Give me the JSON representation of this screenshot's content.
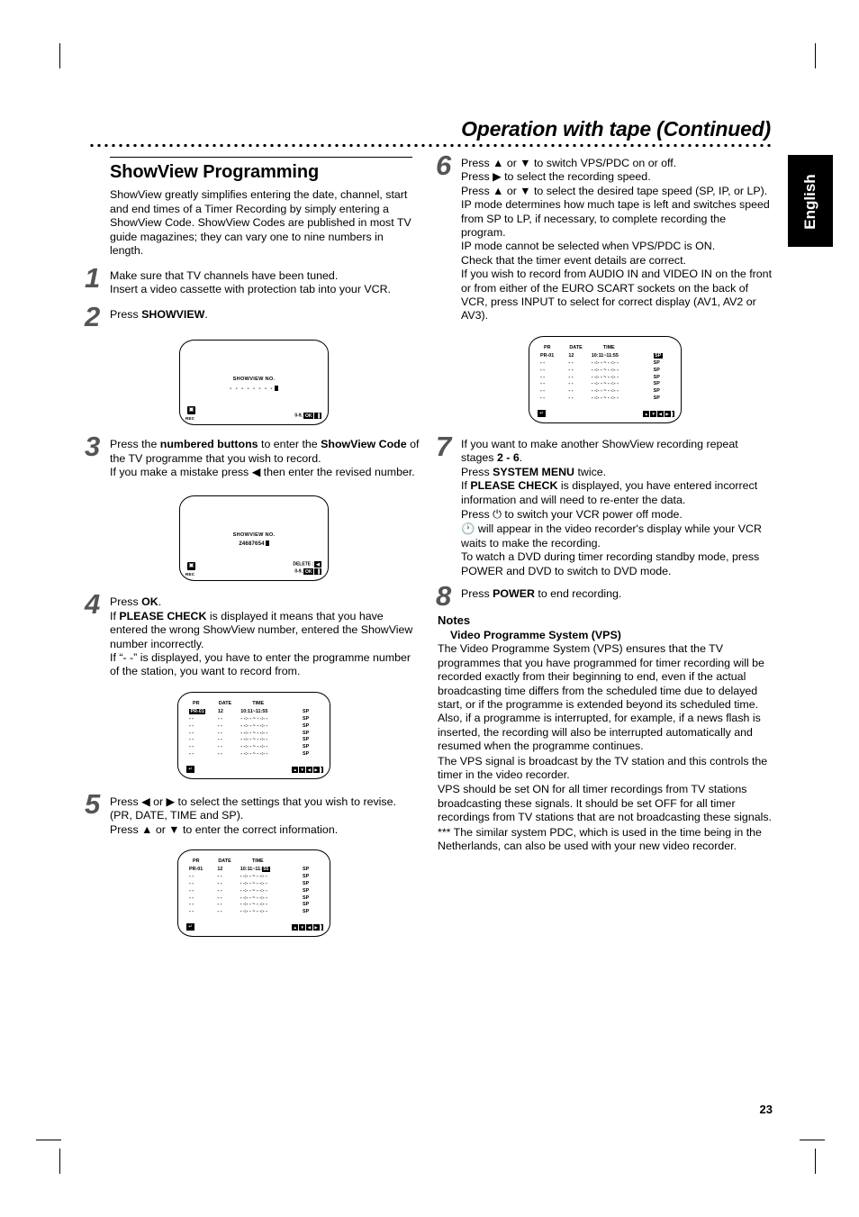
{
  "header": {
    "title": "Operation with tape (Continued)",
    "language_tab": "English",
    "page_number": "23"
  },
  "left_column": {
    "section_title": "ShowView Programming",
    "intro": "ShowView greatly simplifies entering the date, channel, start and end times of a Timer Recording by simply entering a ShowView Code. ShowView Codes are published in most TV guide magazines; they can vary one to nine numbers in length.",
    "steps": [
      {
        "number": "1",
        "lines": [
          "Make sure that TV channels have been tuned.",
          "Insert a video cassette with protection tab into your VCR."
        ]
      },
      {
        "number": "2",
        "lines": [
          "Press SHOWVIEW."
        ],
        "bold_terms": [
          "SHOWVIEW"
        ]
      },
      {
        "number": "3",
        "lines": [
          "Press the numbered buttons to enter the ShowView Code of the TV programme that you wish to record.",
          "If you make a mistake press ◀ then enter the revised number."
        ],
        "bold_terms": [
          "numbered buttons",
          "ShowView Code"
        ]
      },
      {
        "number": "4",
        "lines": [
          "Press OK.",
          "If PLEASE CHECK is displayed it means that you have entered the wrong ShowView number, entered the ShowView number incorrectly.",
          "If “- -” is displayed, you have to enter the programme number of the station, you want to record from."
        ],
        "bold_terms": [
          "OK",
          "PLEASE CHECK"
        ]
      },
      {
        "number": "5",
        "lines": [
          "Press ◀ or ▶ to select the settings that you wish to revise. (PR, DATE, TIME and SP).",
          "Press ▲ or ▼ to enter the correct information."
        ]
      }
    ]
  },
  "right_column": {
    "steps": [
      {
        "number": "6",
        "lines": [
          "Press ▲ or ▼ to switch VPS/PDC on or off.",
          "Press ▶ to select the recording speed.",
          "Press ▲ or ▼ to select the desired tape speed (SP, IP, or LP).",
          "IP mode determines how much tape is left and switches speed from SP to LP, if necessary, to  complete recording the program.",
          "IP mode cannot be selected when VPS/PDC is ON.",
          "Check that the timer event details are correct.",
          "If you wish to record from AUDIO IN and VIDEO IN on the front or from either of the EURO SCART sockets on the back of VCR, press INPUT to select for correct display (AV1, AV2 or AV3)."
        ]
      },
      {
        "number": "7",
        "lines": [
          "If you want to make another ShowView recording repeat stages 2 - 6.",
          "Press SYSTEM MENU twice.",
          "If PLEASE CHECK is displayed, you have entered incorrect information and will need to re-enter the data.",
          "Press ⏻ to switch your VCR power off mode.",
          "🕐 will appear in the video recorder's display while your VCR waits to make the recording.",
          "To watch a DVD during timer recording standby mode, press POWER and DVD to switch to DVD mode."
        ],
        "bold_terms": [
          "2 - 6",
          "SYSTEM MENU",
          "PLEASE CHECK"
        ]
      },
      {
        "number": "8",
        "lines": [
          "Press POWER to end recording."
        ],
        "bold_terms": [
          "POWER"
        ]
      }
    ],
    "notes": {
      "heading": "Notes",
      "subheading": "Video Programme System (VPS)",
      "paragraphs": [
        "The Video Programme System (VPS) ensures that the TV programmes that you have programmed for timer recording will be recorded exactly from their beginning to end, even if the actual broadcasting time differs from the scheduled time due to delayed start, or if the programme is extended beyond its scheduled time. Also, if a programme is interrupted, for example, if a news flash is inserted, the recording will also be interrupted automatically and resumed when the programme continues.",
        "The VPS signal is broadcast by the TV station and this controls the timer in the video recorder.",
        "VPS should be set ON for all timer recordings from TV stations broadcasting these signals. It should be set OFF for all timer recordings from TV stations that are not broadcasting these signals.",
        "*** The similar system PDC, which is used in the time being in the Netherlands, can also be used with your new video recorder."
      ]
    }
  },
  "screens": {
    "showview_empty": {
      "title": "SHOWVIEW NO.",
      "code": "- - - - - - - -",
      "rec_label": "REC",
      "hint": "0-9,",
      "ok_label": "OK"
    },
    "showview_filled": {
      "title": "SHOWVIEW NO.",
      "code": "24687654",
      "rec_label": "REC",
      "delete_label": "DELETE :",
      "delete_key": "◀",
      "hint": "0-9,",
      "ok_label": "OK"
    },
    "timer_pr_selected": {
      "columns": [
        "PR",
        "DATE",
        "TIME",
        ""
      ],
      "rows": [
        {
          "pr": "PR-01",
          "date": "12",
          "time": "10:11~11:55",
          "speed": "SP",
          "highlight": "pr"
        },
        {
          "pr": "- -",
          "date": "- -",
          "time": "- -:- - ~ - -:- -",
          "speed": "SP"
        },
        {
          "pr": "- -",
          "date": "- -",
          "time": "- -:- - ~ - -:- -",
          "speed": "SP"
        },
        {
          "pr": "- -",
          "date": "- -",
          "time": "- -:- - ~ - -:- -",
          "speed": "SP"
        },
        {
          "pr": "- -",
          "date": "- -",
          "time": "- -:- - ~ - -:- -",
          "speed": "SP"
        },
        {
          "pr": "- -",
          "date": "- -",
          "time": "- -:- - ~ - -:- -",
          "speed": "SP"
        },
        {
          "pr": "- -",
          "date": "- -",
          "time": "- -:- - ~ - -:- -",
          "speed": "SP"
        }
      ],
      "nav_keys": [
        "▲",
        "▼",
        "◀",
        "▶"
      ]
    },
    "timer_time_selected": {
      "columns": [
        "PR",
        "DATE",
        "TIME",
        ""
      ],
      "rows": [
        {
          "pr": "PR-01",
          "date": "12",
          "time_prefix": "10:11~11:",
          "time_highlight": "55",
          "speed": "SP",
          "highlight": "time"
        },
        {
          "pr": "- -",
          "date": "- -",
          "time": "- -:- - ~ - -:- -",
          "speed": "SP"
        },
        {
          "pr": "- -",
          "date": "- -",
          "time": "- -:- - ~ - -:- -",
          "speed": "SP"
        },
        {
          "pr": "- -",
          "date": "- -",
          "time": "- -:- - ~ - -:- -",
          "speed": "SP"
        },
        {
          "pr": "- -",
          "date": "- -",
          "time": "- -:- - ~ - -:- -",
          "speed": "SP"
        },
        {
          "pr": "- -",
          "date": "- -",
          "time": "- -:- - ~ - -:- -",
          "speed": "SP"
        },
        {
          "pr": "- -",
          "date": "- -",
          "time": "- -:- - ~ - -:- -",
          "speed": "SP"
        }
      ],
      "nav_keys": [
        "▲",
        "▼",
        "◀",
        "▶"
      ]
    },
    "timer_speed_selected": {
      "columns": [
        "PR",
        "DATE",
        "TIME",
        ""
      ],
      "rows": [
        {
          "pr": "PR-01",
          "date": "12",
          "time": "10:11~11:55",
          "speed": "SP",
          "highlight": "speed"
        },
        {
          "pr": "- -",
          "date": "- -",
          "time": "- -:- - ~ - -:- -",
          "speed": "SP"
        },
        {
          "pr": "- -",
          "date": "- -",
          "time": "- -:- - ~ - -:- -",
          "speed": "SP"
        },
        {
          "pr": "- -",
          "date": "- -",
          "time": "- -:- - ~ - -:- -",
          "speed": "SP"
        },
        {
          "pr": "- -",
          "date": "- -",
          "time": "- -:- - ~ - -:- -",
          "speed": "SP"
        },
        {
          "pr": "- -",
          "date": "- -",
          "time": "- -:- - ~ - -:- -",
          "speed": "SP"
        },
        {
          "pr": "- -",
          "date": "- -",
          "time": "- -:- - ~ - -:- -",
          "speed": "SP"
        }
      ],
      "nav_keys": [
        "▲",
        "▼",
        "◀",
        "▶"
      ]
    }
  }
}
